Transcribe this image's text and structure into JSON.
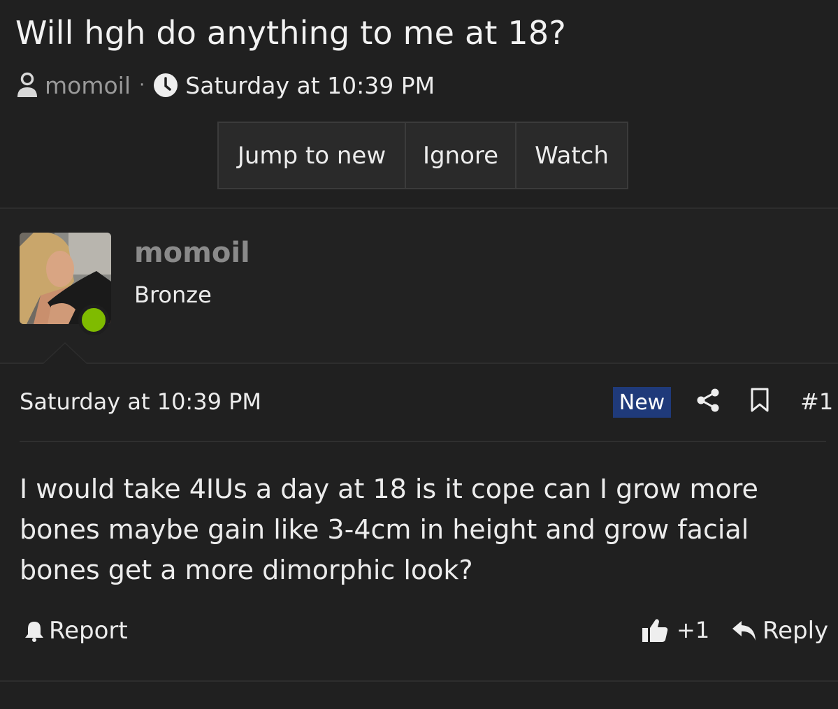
{
  "thread": {
    "title": "Will hgh do anything to me at 18?",
    "author": "momoil",
    "separator": "·",
    "date": "Saturday at 10:39 PM"
  },
  "actions": {
    "jump": "Jump to new",
    "ignore": "Ignore",
    "watch": "Watch"
  },
  "user": {
    "name": "momoil",
    "rank": "Bronze",
    "online": true,
    "online_color": "#7fbb00"
  },
  "post": {
    "date": "Saturday at 10:39 PM",
    "badge": "New",
    "badge_color": "#1f3a7a",
    "number": "#1",
    "body": "I would take 4IUs a day at 18 is it cope can I grow more bones maybe gain like 3-4cm in height and grow facial bones get a more dimorphic look?",
    "report": "Report",
    "likes": "+1",
    "reply": "Reply"
  },
  "icons": {
    "user": "user-icon",
    "clock": "clock-icon",
    "share": "share-icon",
    "bookmark": "bookmark-icon",
    "bell": "bell-icon",
    "thumbs_up": "thumbs-up-icon",
    "reply": "reply-arrow-icon"
  }
}
